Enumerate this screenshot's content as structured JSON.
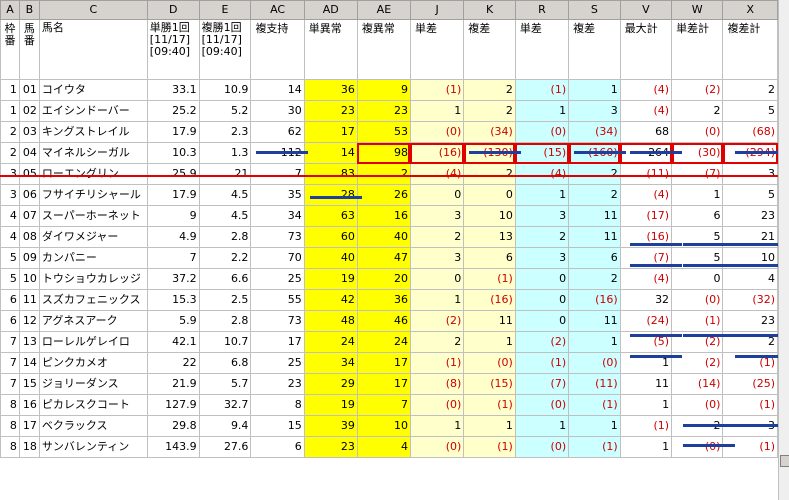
{
  "columns": [
    "A",
    "B",
    "C",
    "D",
    "E",
    "AC",
    "AD",
    "AE",
    "J",
    "K",
    "R",
    "S",
    "V",
    "W",
    "X"
  ],
  "headers": {
    "A": "枠番",
    "B": "馬番",
    "C": "馬名",
    "D": "単勝1回[11/17][09:40]",
    "E": "複勝1回[11/17][09:40]",
    "AC": "複支持",
    "AD": "単異常",
    "AE": "複異常",
    "J": "単差",
    "K": "複差",
    "R": "単差",
    "S": "複差",
    "V": "最大計",
    "W": "単差計",
    "X": "複差計"
  },
  "rows": [
    [
      "1",
      "01",
      "コイウタ",
      "33.1",
      "10.9",
      "14",
      "36",
      "9",
      "(1)",
      "2",
      "(1)",
      "1",
      "(4)",
      "(2)",
      "2"
    ],
    [
      "1",
      "02",
      "エイシンドーバー",
      "25.2",
      "5.2",
      "30",
      "23",
      "23",
      "1",
      "2",
      "1",
      "3",
      "(4)",
      "2",
      "5"
    ],
    [
      "2",
      "03",
      "キングストレイル",
      "17.9",
      "2.3",
      "62",
      "17",
      "53",
      "(0)",
      "(34)",
      "(0)",
      "(34)",
      "68",
      "(0)",
      "(68)"
    ],
    [
      "2",
      "04",
      "マイネルシーガル",
      "10.3",
      "1.3",
      "112",
      "14",
      "98",
      "(16)",
      "(130)",
      "(15)",
      "(160)",
      "264",
      "(30)",
      "(294)"
    ],
    [
      "3",
      "05",
      "ローエングリン",
      "25.9",
      "21",
      "7",
      "83",
      "2",
      "(4)",
      "2",
      "(4)",
      "2",
      "(11)",
      "(7)",
      "3"
    ],
    [
      "3",
      "06",
      "フサイチリシャール",
      "17.9",
      "4.5",
      "35",
      "28",
      "26",
      "0",
      "0",
      "1",
      "2",
      "(4)",
      "1",
      "5"
    ],
    [
      "4",
      "07",
      "スーパーホーネット",
      "9",
      "4.5",
      "34",
      "63",
      "16",
      "3",
      "10",
      "3",
      "11",
      "(17)",
      "6",
      "23"
    ],
    [
      "4",
      "08",
      "ダイワメジャー",
      "4.9",
      "2.8",
      "73",
      "60",
      "40",
      "2",
      "13",
      "2",
      "11",
      "(16)",
      "5",
      "21"
    ],
    [
      "5",
      "09",
      "カンパニー",
      "7",
      "2.2",
      "70",
      "40",
      "47",
      "3",
      "6",
      "3",
      "6",
      "(7)",
      "5",
      "10"
    ],
    [
      "5",
      "10",
      "トウショウカレッジ",
      "37.2",
      "6.6",
      "25",
      "19",
      "20",
      "0",
      "(1)",
      "0",
      "2",
      "(4)",
      "0",
      "4"
    ],
    [
      "6",
      "11",
      "スズカフェニックス",
      "15.3",
      "2.5",
      "55",
      "42",
      "36",
      "1",
      "(16)",
      "0",
      "(16)",
      "32",
      "(0)",
      "(32)"
    ],
    [
      "6",
      "12",
      "アグネスアーク",
      "5.9",
      "2.8",
      "73",
      "48",
      "46",
      "(2)",
      "11",
      "0",
      "11",
      "(24)",
      "(1)",
      "23"
    ],
    [
      "7",
      "13",
      "ローレルゲレイロ",
      "42.1",
      "10.7",
      "17",
      "24",
      "24",
      "2",
      "1",
      "(2)",
      "1",
      "(5)",
      "(2)",
      "2"
    ],
    [
      "7",
      "14",
      "ピンクカメオ",
      "22",
      "6.8",
      "25",
      "34",
      "17",
      "(1)",
      "(0)",
      "(1)",
      "(0)",
      "1",
      "(2)",
      "(1)"
    ],
    [
      "7",
      "15",
      "ジョリーダンス",
      "21.9",
      "5.7",
      "23",
      "29",
      "17",
      "(8)",
      "(15)",
      "(7)",
      "(11)",
      "11",
      "(14)",
      "(25)"
    ],
    [
      "8",
      "16",
      "ピカレスクコート",
      "127.9",
      "32.7",
      "8",
      "19",
      "7",
      "(0)",
      "(1)",
      "(0)",
      "(1)",
      "1",
      "(0)",
      "(1)"
    ],
    [
      "8",
      "17",
      "ベクラックス",
      "29.8",
      "9.4",
      "15",
      "39",
      "10",
      "1",
      "1",
      "1",
      "1",
      "(1)",
      "2",
      "3"
    ],
    [
      "8",
      "18",
      "サンバレンティン",
      "143.9",
      "27.6",
      "6",
      "23",
      "4",
      "(0)",
      "(1)",
      "(0)",
      "(1)",
      "1",
      "(0)",
      "(1)"
    ]
  ]
}
